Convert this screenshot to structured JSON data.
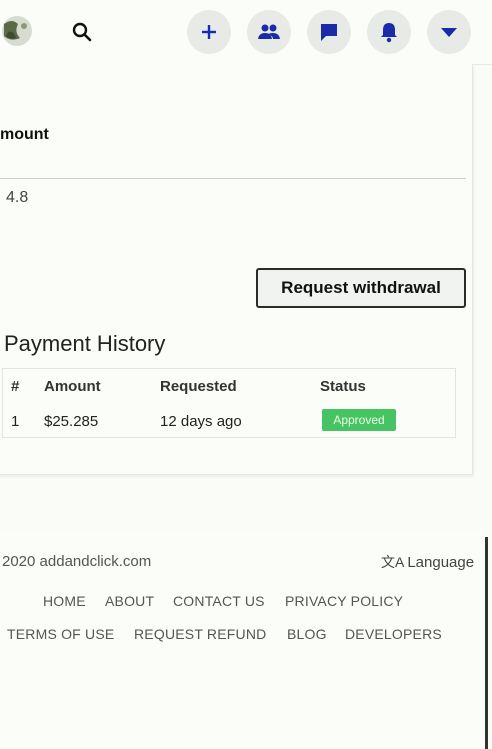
{
  "nav": {
    "icons": [
      "moon-logo-icon",
      "search-icon",
      "plus-icon",
      "friends-icon",
      "chat-icon",
      "bell-icon",
      "caret-down-icon"
    ]
  },
  "withdraw": {
    "amount_label": "mount",
    "amount_value": "4.8",
    "button_label": "Request withdrawal"
  },
  "history": {
    "title": "Payment History",
    "columns": [
      "#",
      "Amount",
      "Requested",
      "Status"
    ],
    "rows": [
      {
        "num": "1",
        "amount": "$25.285",
        "requested": "12 days ago",
        "status": "Approved"
      }
    ],
    "status_color": "#46c463"
  },
  "footer": {
    "copyright": "2020 addandclick.com",
    "language_label": "Language",
    "links": [
      "HOME",
      "ABOUT",
      "CONTACT US",
      "PRIVACY POLICY",
      "TERMS OF USE",
      "REQUEST REFUND",
      "BLOG",
      "DEVELOPERS"
    ]
  },
  "colors": {
    "nav_icon": "#1a2aa8",
    "nav_button_bg": "#e7eae6"
  }
}
